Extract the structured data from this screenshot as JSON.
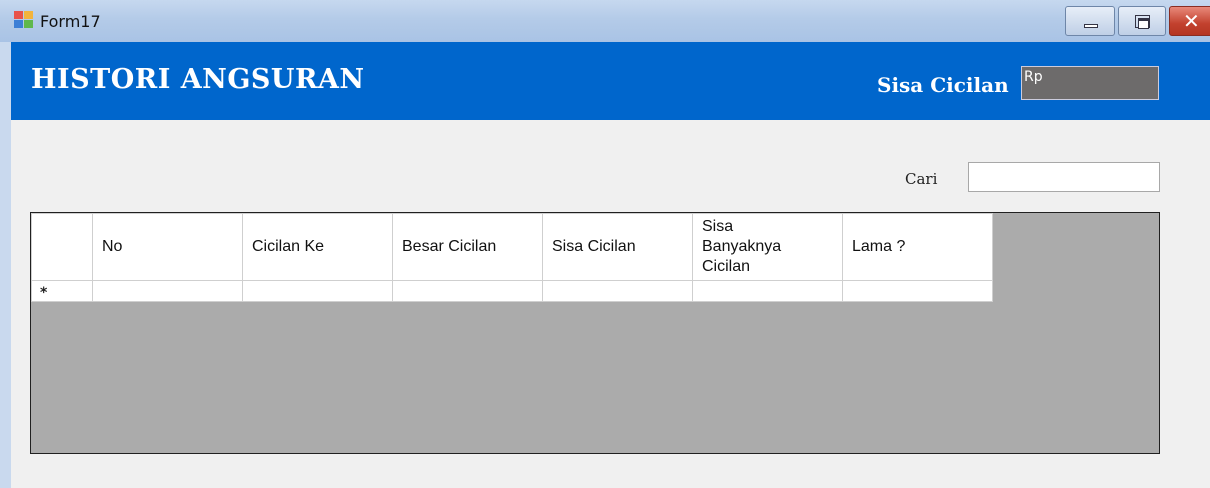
{
  "window": {
    "title": "Form17",
    "close_glyph": "✕"
  },
  "header": {
    "title": "HISTORI ANGSURAN",
    "sisa_label": "Sisa Cicilan",
    "sisa_value": "Rp"
  },
  "search": {
    "label": "Cari",
    "value": ""
  },
  "grid": {
    "columns": [
      "No",
      "Cicilan Ke",
      "Besar Cicilan",
      "Sisa Cicilan",
      "Sisa Banyaknya Cicilan",
      "Lama ?"
    ],
    "new_row_marker": "*"
  },
  "colors": {
    "header_bg": "#0066cc",
    "grid_bg": "#ababab",
    "sisa_box_bg": "#6d6b6b"
  }
}
